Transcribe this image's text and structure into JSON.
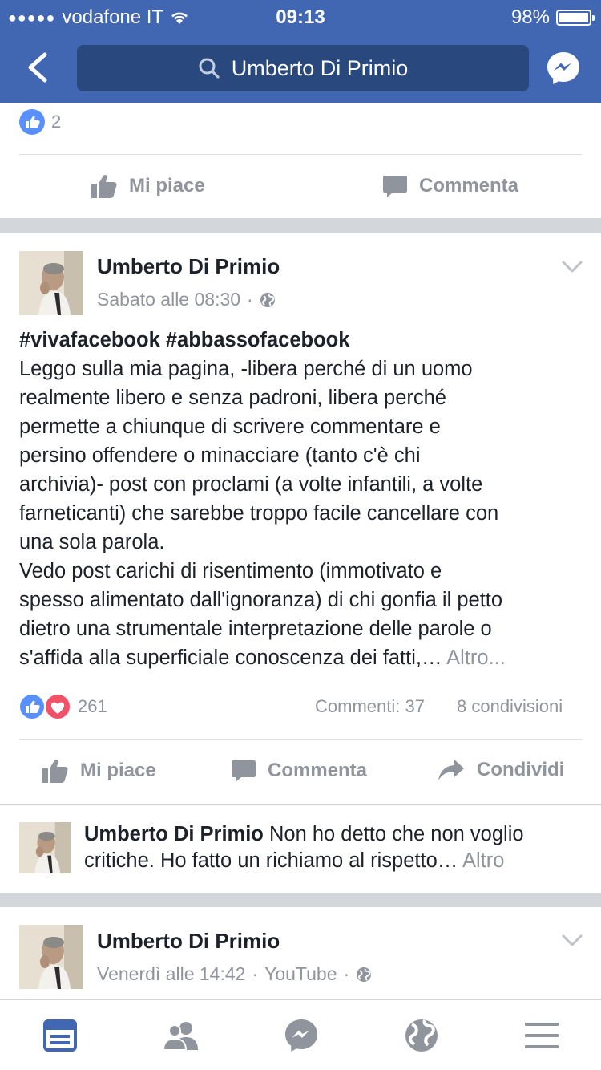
{
  "status": {
    "carrier": "vodafone IT",
    "time": "09:13",
    "battery": "98%"
  },
  "nav": {
    "search_text": "Umberto Di Primio"
  },
  "prev_post": {
    "like_count": "2",
    "like_label": "Mi piace",
    "comment_label": "Commenta"
  },
  "post": {
    "author": "Umberto Di Primio",
    "time": "Sabato alle 08:30",
    "dot": "·",
    "hashtags": "#vivafacebook #abbassofacebook",
    "lines": [
      "Leggo sulla mia pagina, -libera perché di un uomo",
      "realmente libero e senza padroni, libera perché",
      "permette a chiunque di scrivere commentare e",
      "persino offendere o minacciare (tanto c'è chi",
      "archivia)- post con proclami (a volte infantili, a volte",
      "farneticanti) che sarebbe troppo facile cancellare con",
      "una sola parola.",
      "Vedo post carichi di risentimento (immotivato e",
      "spesso alimentato dall'ignoranza) di chi gonfia il petto",
      "dietro una strumentale interpretazione delle parole o",
      "s'affida alla superficiale conoscenza dei fatti,…"
    ],
    "more": "Altro...",
    "reactions_count": "261",
    "comments_count": "Commenti: 37",
    "shares_count": "8 condivisioni",
    "like_label": "Mi piace",
    "comment_label": "Commenta",
    "share_label": "Condividi"
  },
  "comment": {
    "author": "Umberto Di Primio",
    "text_1": "Non ho detto che non voglio",
    "text_2": "critiche. Ho fatto un richiamo al rispetto…",
    "more": "Altro"
  },
  "next_post": {
    "author": "Umberto Di Primio",
    "time": "Venerdì alle 14:42",
    "dot1": "·",
    "source": "YouTube",
    "dot2": "·"
  },
  "colors": {
    "brand": "#4267b2",
    "brand_dark": "#29487d",
    "like_blue": "#5890ff",
    "love_red": "#f25268",
    "muted": "#90949c"
  },
  "icons": {
    "tabs": [
      "news-feed-icon",
      "friends-icon",
      "messenger-icon",
      "globe-icon",
      "menu-icon"
    ]
  }
}
